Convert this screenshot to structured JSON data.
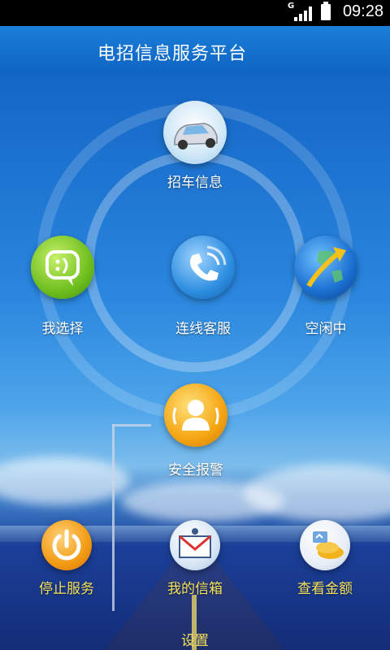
{
  "status_bar": {
    "network_type": "G",
    "time": "09:28",
    "icons": [
      "signal-icon",
      "battery-icon"
    ]
  },
  "header": {
    "title": "电招信息服务平台"
  },
  "main_menu": {
    "car_info": {
      "label": "招车信息",
      "icon": "car-icon"
    },
    "my_choice": {
      "label": "我选择",
      "icon": "chat-bubble-icon"
    },
    "customer_service": {
      "label": "连线客服",
      "icon": "phone-icon"
    },
    "status": {
      "label": "空闲中",
      "icon": "globe-arrow-icon"
    },
    "safety_alarm": {
      "label": "安全报警",
      "icon": "person-alert-icon"
    }
  },
  "bottom_menu": {
    "stop_service": {
      "label": "停止服务",
      "icon": "power-icon"
    },
    "my_mailbox": {
      "label": "我的信箱",
      "icon": "mail-icon"
    },
    "check_amount": {
      "label": "查看金额",
      "icon": "coins-icon"
    }
  },
  "footer": {
    "settings_label": "设置"
  },
  "colors": {
    "title_bar": "#1575d2",
    "label_white": "#ffffff",
    "label_yellow": "#f6e15a"
  }
}
